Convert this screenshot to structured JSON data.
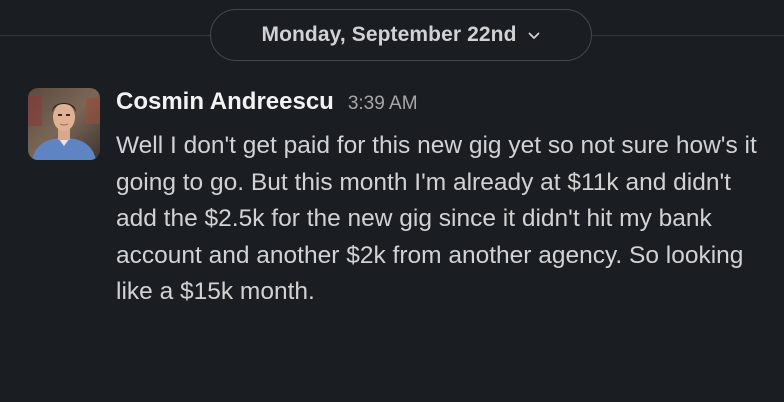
{
  "divider": {
    "date_label": "Monday, September 22nd",
    "chevron_icon": "chevron-down-icon"
  },
  "message": {
    "author": "Cosmin Andreescu",
    "timestamp": "3:39 AM",
    "avatar_icon": "user-avatar-photo",
    "text": "Well I don't get paid for this new gig yet so not sure how's it going to go. But this month I'm already at $11k and didn't add the $2.5k for the new gig since it didn't hit my bank account and another $2k from another agency. So looking like a $15k month."
  },
  "colors": {
    "background": "#1a1d21",
    "text": "#d1d2d3",
    "author": "#f2f2f2",
    "timestamp": "#a6a7a9",
    "divider": "#35373b"
  }
}
